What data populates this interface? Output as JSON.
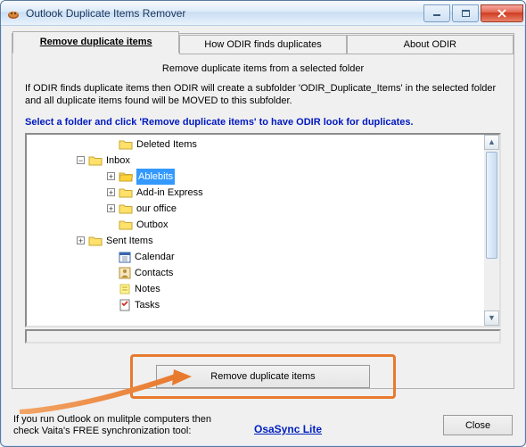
{
  "window": {
    "title": "Outlook Duplicate Items Remover"
  },
  "tabs": {
    "remove": "Remove duplicate items",
    "how": "How ODIR finds duplicates",
    "about": "About ODIR"
  },
  "content": {
    "intro": "Remove duplicate items from a selected folder",
    "desc": "If ODIR finds duplicate items then ODIR will create a subfolder 'ODIR_Duplicate_Items' in the selected folder and all duplicate items found will be MOVED to this subfolder.",
    "prompt": "Select a folder and click 'Remove duplicate items' to have ODIR look for duplicates."
  },
  "tree": {
    "items": [
      {
        "label": "Deleted Items",
        "depth": 2,
        "toggle": "",
        "icon": "folder"
      },
      {
        "label": "Inbox",
        "depth": 1,
        "toggle": "-",
        "icon": "folder"
      },
      {
        "label": "Ablebits",
        "depth": 2,
        "toggle": "+",
        "icon": "folder-open",
        "selected": true
      },
      {
        "label": "Add-in Express",
        "depth": 2,
        "toggle": "+",
        "icon": "folder"
      },
      {
        "label": "our office",
        "depth": 2,
        "toggle": "+",
        "icon": "folder"
      },
      {
        "label": "Outbox",
        "depth": 2,
        "toggle": "",
        "icon": "folder"
      },
      {
        "label": "Sent Items",
        "depth": 1,
        "toggle": "+",
        "icon": "folder"
      },
      {
        "label": "Calendar",
        "depth": 2,
        "toggle": "",
        "icon": "calendar"
      },
      {
        "label": "Contacts",
        "depth": 2,
        "toggle": "",
        "icon": "contacts"
      },
      {
        "label": "Notes",
        "depth": 2,
        "toggle": "",
        "icon": "notes"
      },
      {
        "label": "Tasks",
        "depth": 2,
        "toggle": "",
        "icon": "tasks"
      }
    ]
  },
  "buttons": {
    "remove": "Remove duplicate items",
    "close": "Close"
  },
  "promo": {
    "text": "If you run Outlook on mulitple computers then check Vaita's FREE synchronization tool:",
    "link": "OsaSync Lite"
  }
}
